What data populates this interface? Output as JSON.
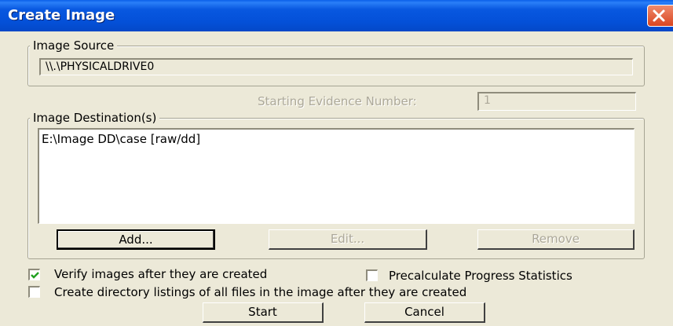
{
  "window": {
    "title": "Create Image"
  },
  "image_source": {
    "legend": "Image Source",
    "value": "\\\\.\\PHYSICALDRIVE0"
  },
  "evidence": {
    "label": "Starting Evidence Number:",
    "value": "1"
  },
  "image_destinations": {
    "legend": "Image Destination(s)",
    "items": [
      "E:\\Image DD\\case [raw/dd]"
    ],
    "add_label": "Add...",
    "edit_label": "Edit...",
    "remove_label": "Remove"
  },
  "options": {
    "verify": {
      "label": "Verify images after they are created",
      "checked": true
    },
    "precalc": {
      "label": "Precalculate Progress Statistics",
      "checked": false
    },
    "dir_listings": {
      "label": "Create directory listings of all files in the image after they are created",
      "checked": false
    }
  },
  "footer": {
    "start_label": "Start",
    "cancel_label": "Cancel"
  }
}
